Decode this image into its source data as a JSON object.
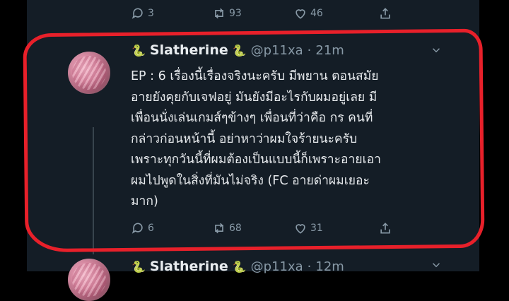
{
  "prev_tweet": {
    "actions": {
      "replies": "3",
      "retweets": "93",
      "likes": "46"
    }
  },
  "tweet": {
    "display_name": "Slatherine",
    "handle": "@p11xa",
    "separator": "·",
    "time": "21m",
    "lines": [
      "EP : 6 เรื่องนี้เรื่องจริงนะครับ มีพยาน ตอนสมัย",
      "อายยังคุยกับเจฟอยู่ มันยังมีอะไรกับผมอยู่เลย มี",
      "เพื่อนนั่งเล่นเกมส์ๆข้างๆ เพื่อนที่ว่าคือ กร คนที่",
      "กล่าวก่อนหน้านี้ อย่าหาว่าผมใจร้ายนะครับ",
      "เพราะทุกวันนี้ที่ผมต้องเป็นแบบนี้ก็เพราะอายเอา",
      "ผมไปพูดในสิ่งที่มันไม่จริง (FC อายด่าผมเยอะ",
      "มาก)"
    ],
    "actions": {
      "replies": "6",
      "retweets": "68",
      "likes": "31"
    }
  },
  "next_tweet": {
    "display_name": "Slatherine",
    "handle": "@p11xa",
    "separator": "·",
    "time": "12m"
  },
  "colors": {
    "background": "#141d26",
    "muted": "#8899a6",
    "annotation": "#e8202a"
  }
}
